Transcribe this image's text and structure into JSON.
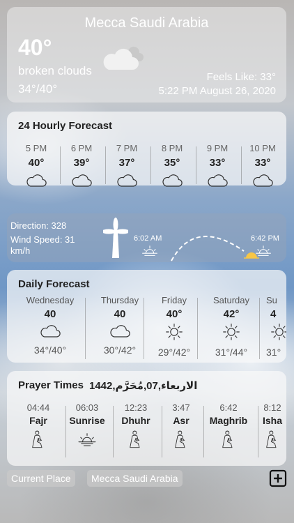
{
  "current": {
    "city": "Mecca Saudi Arabia",
    "temp": "40°",
    "condition": "broken clouds",
    "range": "34°/40°",
    "feels_like": "Feels Like: 33°",
    "datetime": "5:22 PM August 26, 2020",
    "icon": "broken-clouds-icon"
  },
  "hourly": {
    "title": "24 Hourly Forecast",
    "items": [
      {
        "time": "5 PM",
        "temp": "40°",
        "icon": "cloud-icon"
      },
      {
        "time": "6 PM",
        "temp": "39°",
        "icon": "cloud-icon"
      },
      {
        "time": "7 PM",
        "temp": "37°",
        "icon": "cloud-icon"
      },
      {
        "time": "8 PM",
        "temp": "35°",
        "icon": "cloud-icon"
      },
      {
        "time": "9 PM",
        "temp": "33°",
        "icon": "cloud-icon"
      },
      {
        "time": "10 PM",
        "temp": "33°",
        "icon": "cloud-icon"
      }
    ]
  },
  "wind": {
    "direction": "Direction: 328",
    "speed": "Wind Speed: 31",
    "unit": "km/h",
    "sunrise": "6:02 AM",
    "sunset": "6:42 PM"
  },
  "daily": {
    "title": "Daily Forecast",
    "items": [
      {
        "day": "Wednesday",
        "temp": "40",
        "range": "34°/40°",
        "icon": "cloud-icon"
      },
      {
        "day": "Thursday",
        "temp": "40",
        "range": "30°/42°",
        "icon": "cloud-icon"
      },
      {
        "day": "Friday",
        "temp": "40°",
        "range": "29°/42°",
        "icon": "sun-icon"
      },
      {
        "day": "Saturday",
        "temp": "42°",
        "range": "31°/44°",
        "icon": "sun-icon"
      },
      {
        "day": "Su",
        "temp": "4",
        "range": "31°",
        "icon": "sun-icon"
      }
    ]
  },
  "prayer": {
    "title": "Prayer Times",
    "hijri": "الاربعاء,07,مُحَرَّم,1442",
    "items": [
      {
        "time": "04:44",
        "name": "Fajr",
        "icon": "praying-person-icon"
      },
      {
        "time": "06:03",
        "name": "Sunrise",
        "icon": "sunrise-icon"
      },
      {
        "time": "12:23",
        "name": "Dhuhr",
        "icon": "praying-person-icon"
      },
      {
        "time": "3:47",
        "name": "Asr",
        "icon": "praying-person-icon"
      },
      {
        "time": "6:42",
        "name": "Maghrib",
        "icon": "praying-person-icon"
      },
      {
        "time": "8:12",
        "name": "Isha",
        "icon": "praying-person-icon"
      }
    ]
  },
  "bottom": {
    "current_place": "Current Place",
    "city": "Mecca Saudi Arabia",
    "add_icon": "plus-icon"
  }
}
